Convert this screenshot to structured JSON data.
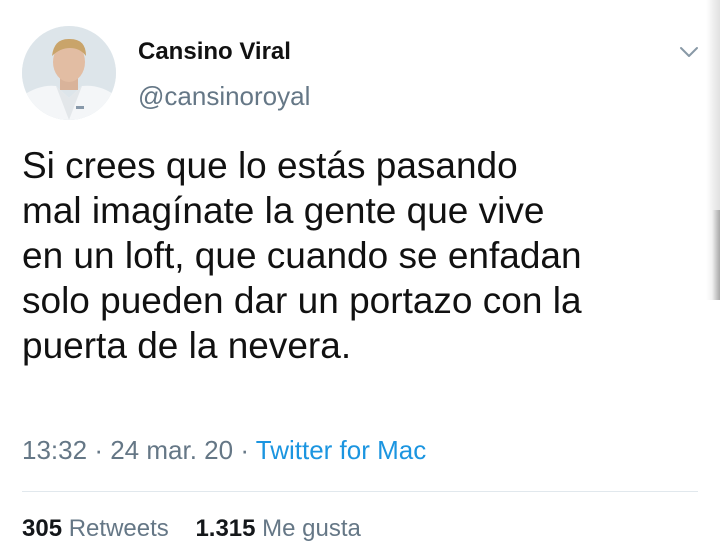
{
  "tweet": {
    "author": {
      "display_name": "Cansino Viral",
      "handle": "@cansinoroyal",
      "avatar_icon": "person-in-white-coat-avatar"
    },
    "menu_icon": "chevron-down-icon",
    "text_lines": [
      "Si crees que lo estás pasando",
      "mal imagínate la gente que vive",
      "en un loft, que cuando se enfadan",
      "solo pueden dar un portazo con la",
      "puerta de la nevera."
    ],
    "time": "13:32",
    "separator": "·",
    "date": "24 mar. 20",
    "source": "Twitter for Mac",
    "retweets_count": "305",
    "retweets_label": "Retweets",
    "likes_count": "1.315",
    "likes_label": "Me gusta"
  },
  "colors": {
    "text": "#14171a",
    "secondary": "#657786",
    "link": "#1b95e0",
    "divider": "#e1e8ed"
  }
}
